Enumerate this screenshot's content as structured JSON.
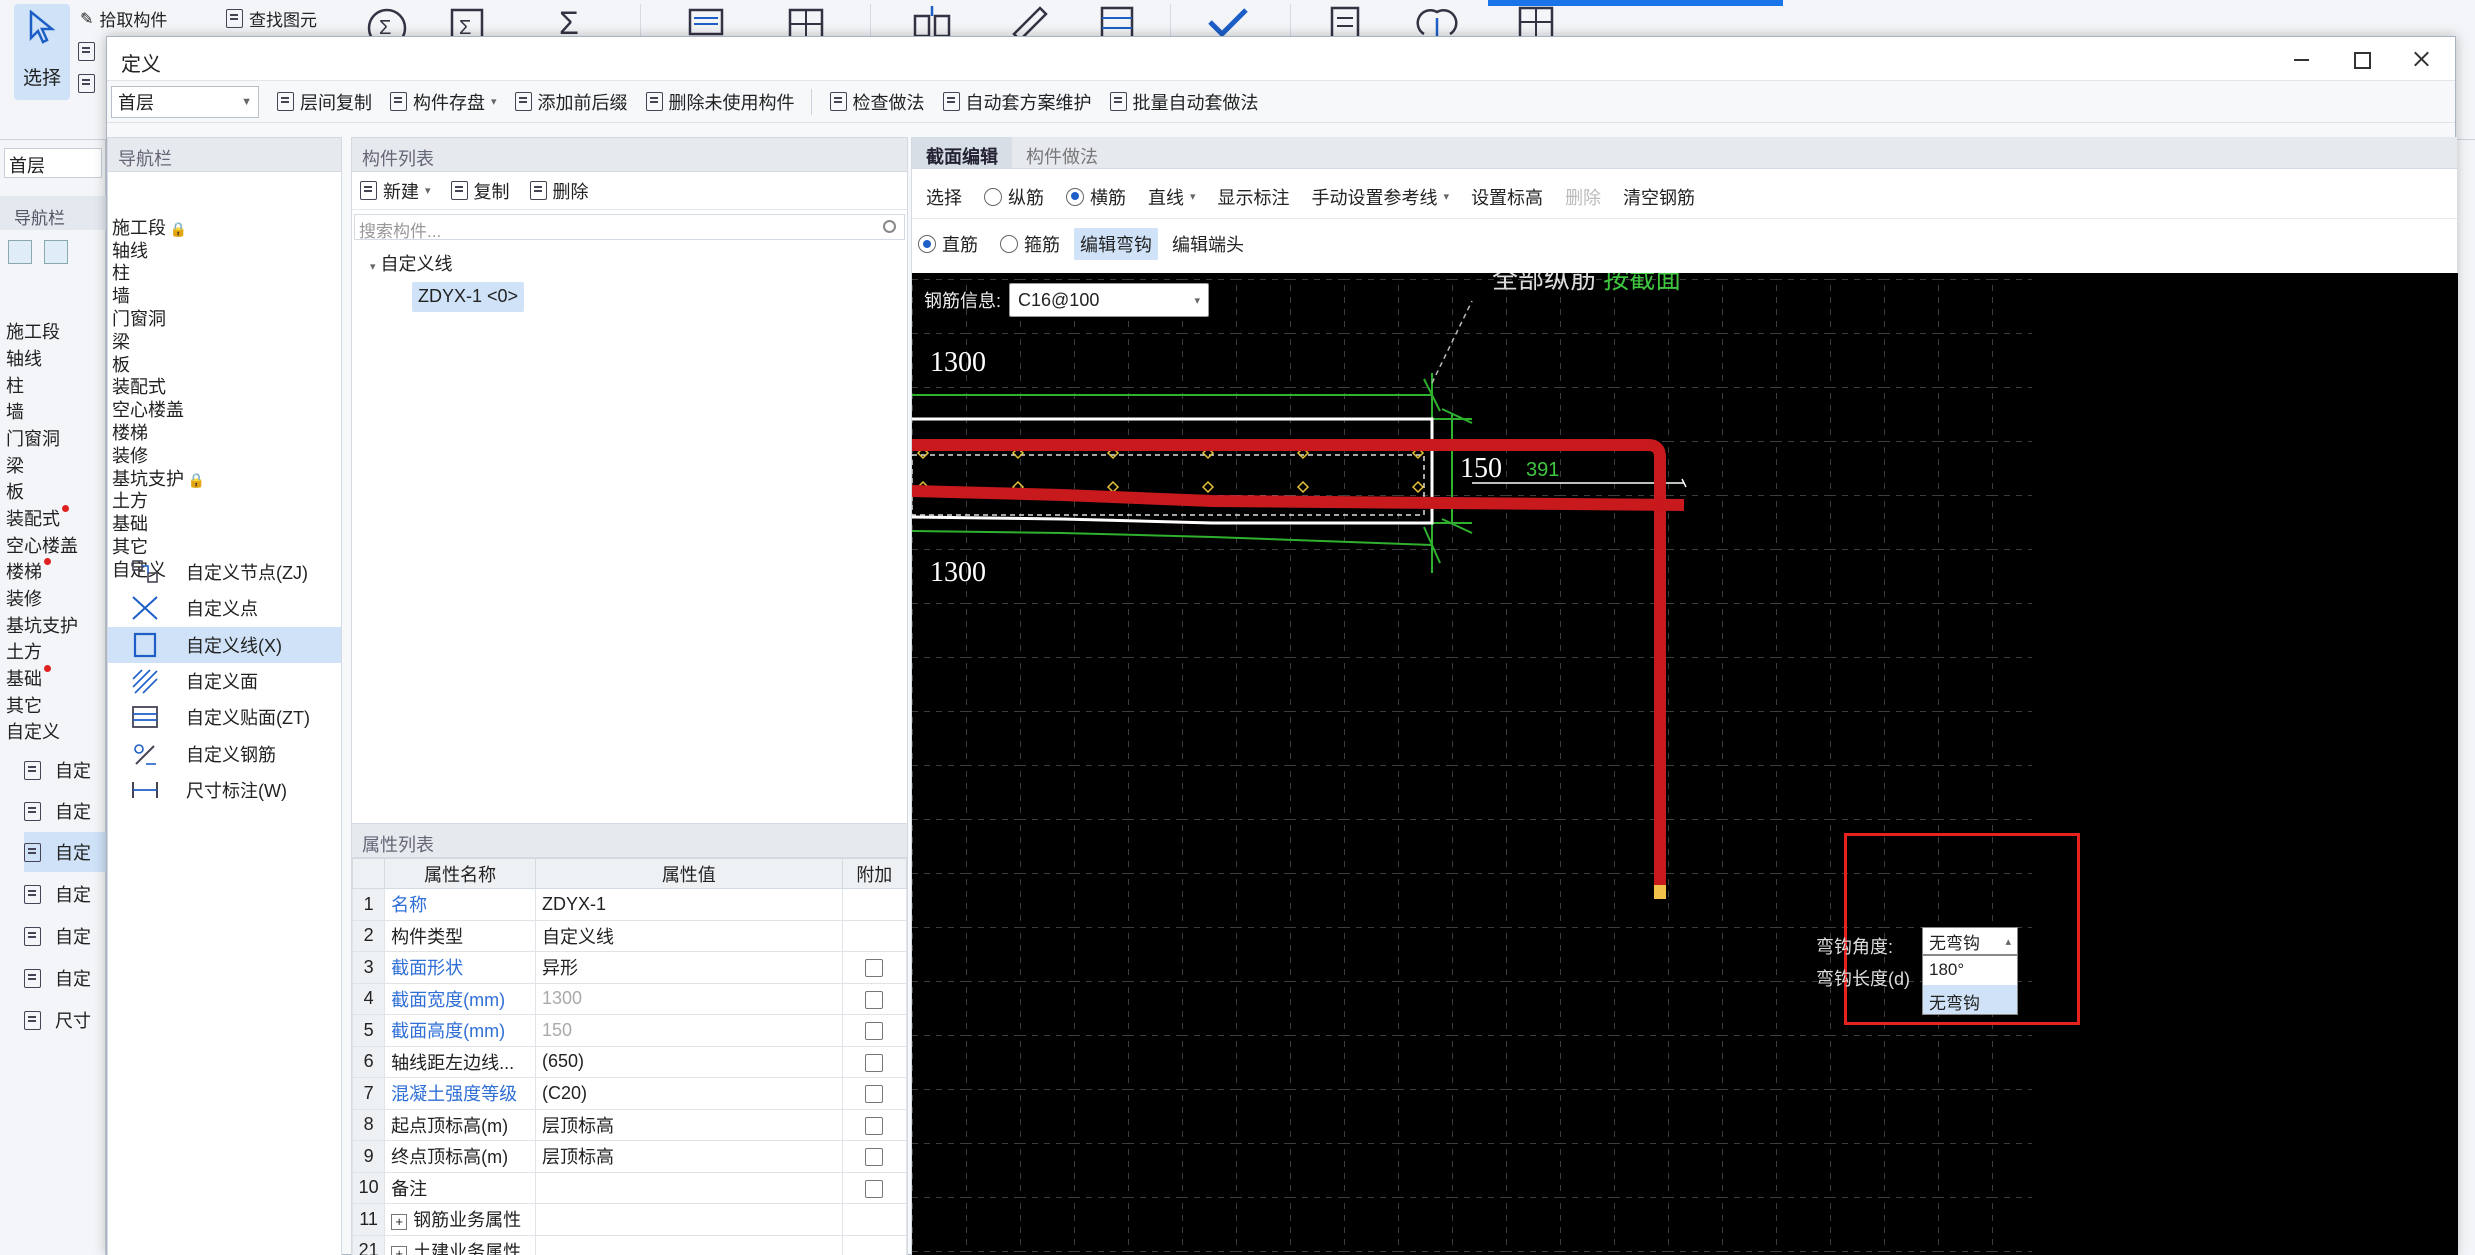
{
  "bg": {
    "select_label": "选择",
    "pick_label": "拾取构件",
    "find_label": "查找图元",
    "floor": "首层",
    "nav_title": "导航栏",
    "nav_items": [
      "施工段",
      "轴线",
      "柱",
      "墙",
      "门窗洞",
      "梁",
      "板",
      "装配式",
      "空心楼盖",
      "楼梯",
      "装修",
      "基坑支护",
      "土方",
      "基础",
      "其它",
      "自定义"
    ],
    "sub_items": [
      "自定",
      "自定",
      "自定",
      "自定",
      "自定",
      "自定",
      "尺寸"
    ]
  },
  "dialog": {
    "title": "定义",
    "floor_select": "首层",
    "toolbar": [
      {
        "label": "层间复制"
      },
      {
        "label": "构件存盘",
        "caret": "▾"
      },
      {
        "label": "添加前后缀"
      },
      {
        "label": "删除未使用构件"
      },
      {
        "label": "检查做法"
      },
      {
        "label": "自动套方案维护"
      },
      {
        "label": "批量自动套做法"
      }
    ]
  },
  "nav": {
    "title": "导航栏",
    "items": [
      "施工段",
      "轴线",
      "柱",
      "墙",
      "门窗洞",
      "梁",
      "板",
      "装配式",
      "空心楼盖",
      "楼梯",
      "装修",
      "基坑支护",
      "土方",
      "基础",
      "其它",
      "自定义"
    ],
    "sub_items": [
      {
        "label": "自定义节点(ZJ)",
        "icon": "custom-node-icon"
      },
      {
        "label": "自定义点",
        "icon": "custom-point-icon"
      },
      {
        "label": "自定义线(X)",
        "icon": "custom-line-icon"
      },
      {
        "label": "自定义面",
        "icon": "custom-face-icon"
      },
      {
        "label": "自定义贴面(ZT)",
        "icon": "custom-facing-icon"
      },
      {
        "label": "自定义钢筋",
        "icon": "custom-rebar-icon"
      },
      {
        "label": "尺寸标注(W)",
        "icon": "dimension-icon"
      }
    ],
    "selected_sub": "自定义线(X)"
  },
  "components": {
    "title": "构件列表",
    "new_label": "新建",
    "copy_label": "复制",
    "delete_label": "删除",
    "search_placeholder": "搜索构件...",
    "tree_root": "自定义线",
    "tree_leaf": "ZDYX-1 <0>"
  },
  "properties": {
    "title": "属性列表",
    "headers": [
      "属性名称",
      "属性值",
      "附加"
    ],
    "rows": [
      {
        "num": "1",
        "name": "名称",
        "value": "ZDYX-1"
      },
      {
        "num": "2",
        "name": "构件类型",
        "value": "自定义线"
      },
      {
        "num": "3",
        "name": "截面形状",
        "value": "异形"
      },
      {
        "num": "4",
        "name": "截面宽度(mm)",
        "value": "1300"
      },
      {
        "num": "5",
        "name": "截面高度(mm)",
        "value": "150"
      },
      {
        "num": "6",
        "name": "轴线距左边线...",
        "value": "(650)"
      },
      {
        "num": "7",
        "name": "混凝土强度等级",
        "value": "(C20)"
      },
      {
        "num": "8",
        "name": "起点顶标高(m)",
        "value": "层顶标高"
      },
      {
        "num": "9",
        "name": "终点顶标高(m)",
        "value": "层顶标高"
      },
      {
        "num": "10",
        "name": "备注",
        "value": ""
      },
      {
        "num": "11",
        "name": "钢筋业务属性",
        "value": ""
      },
      {
        "num": "21",
        "name": "土建业务属性",
        "value": ""
      }
    ]
  },
  "editor": {
    "tabs": [
      "截面编辑",
      "构件做法"
    ],
    "row1": {
      "select": "选择",
      "longitudinal": "纵筋",
      "transverse": "横筋",
      "line": "直线",
      "show_dim": "显示标注",
      "manual_ref": "手动设置参考线",
      "set_elev": "设置标高",
      "delete": "删除",
      "clear": "清空钢筋"
    },
    "row2": {
      "straight": "直筋",
      "stirrup": "箍筋",
      "edit_hook": "编辑弯钩",
      "edit_end": "编辑端头"
    },
    "rebar_info_label": "钢筋信息:",
    "rebar_info_value": "C16@100",
    "top_note_a": "全部纵筋",
    "top_note_b": "按截面",
    "dims": {
      "top": "1300",
      "bottom": "1300",
      "height": "150",
      "green": "391"
    },
    "hook": {
      "angle_label": "弯钩角度:",
      "length_label": "弯钩长度(d)",
      "selected": "无弯钩",
      "options": [
        "180°",
        "无弯钩"
      ]
    }
  }
}
